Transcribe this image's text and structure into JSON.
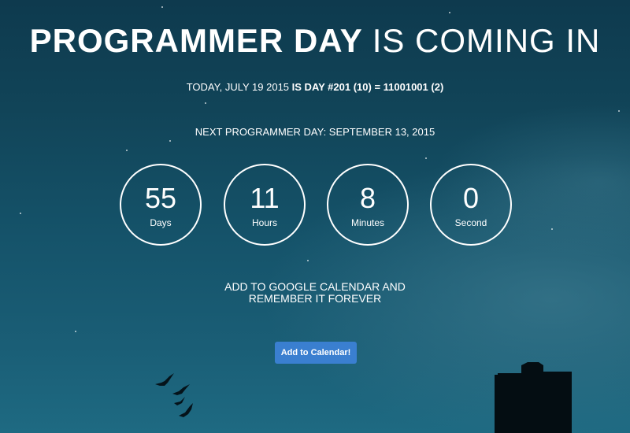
{
  "title": {
    "bold": "PROGRAMMER DAY",
    "light": "IS COMING IN"
  },
  "today": {
    "prefix": "TODAY, JULY 19 2015",
    "highlight": "IS DAY #201 (10) = 11001001 (2)"
  },
  "next_day": "NEXT PROGRAMMER DAY: SEPTEMBER 13, 2015",
  "countdown": [
    {
      "value": "55",
      "unit": "Days"
    },
    {
      "value": "11",
      "unit": "Hours"
    },
    {
      "value": "8",
      "unit": "Minutes"
    },
    {
      "value": "0",
      "unit": "Second"
    }
  ],
  "reminder": {
    "line1": "ADD TO GOOGLE CALENDAR AND",
    "line2": "REMEMBER IT FOREVER"
  },
  "add_button_label": "Add to Calendar!",
  "colors": {
    "button": "#3a7fd0",
    "background_top": "#0e3a4e",
    "background_bottom": "#1e6a82"
  },
  "decorations": [
    "birds-silhouette",
    "building-silhouette",
    "stars"
  ]
}
